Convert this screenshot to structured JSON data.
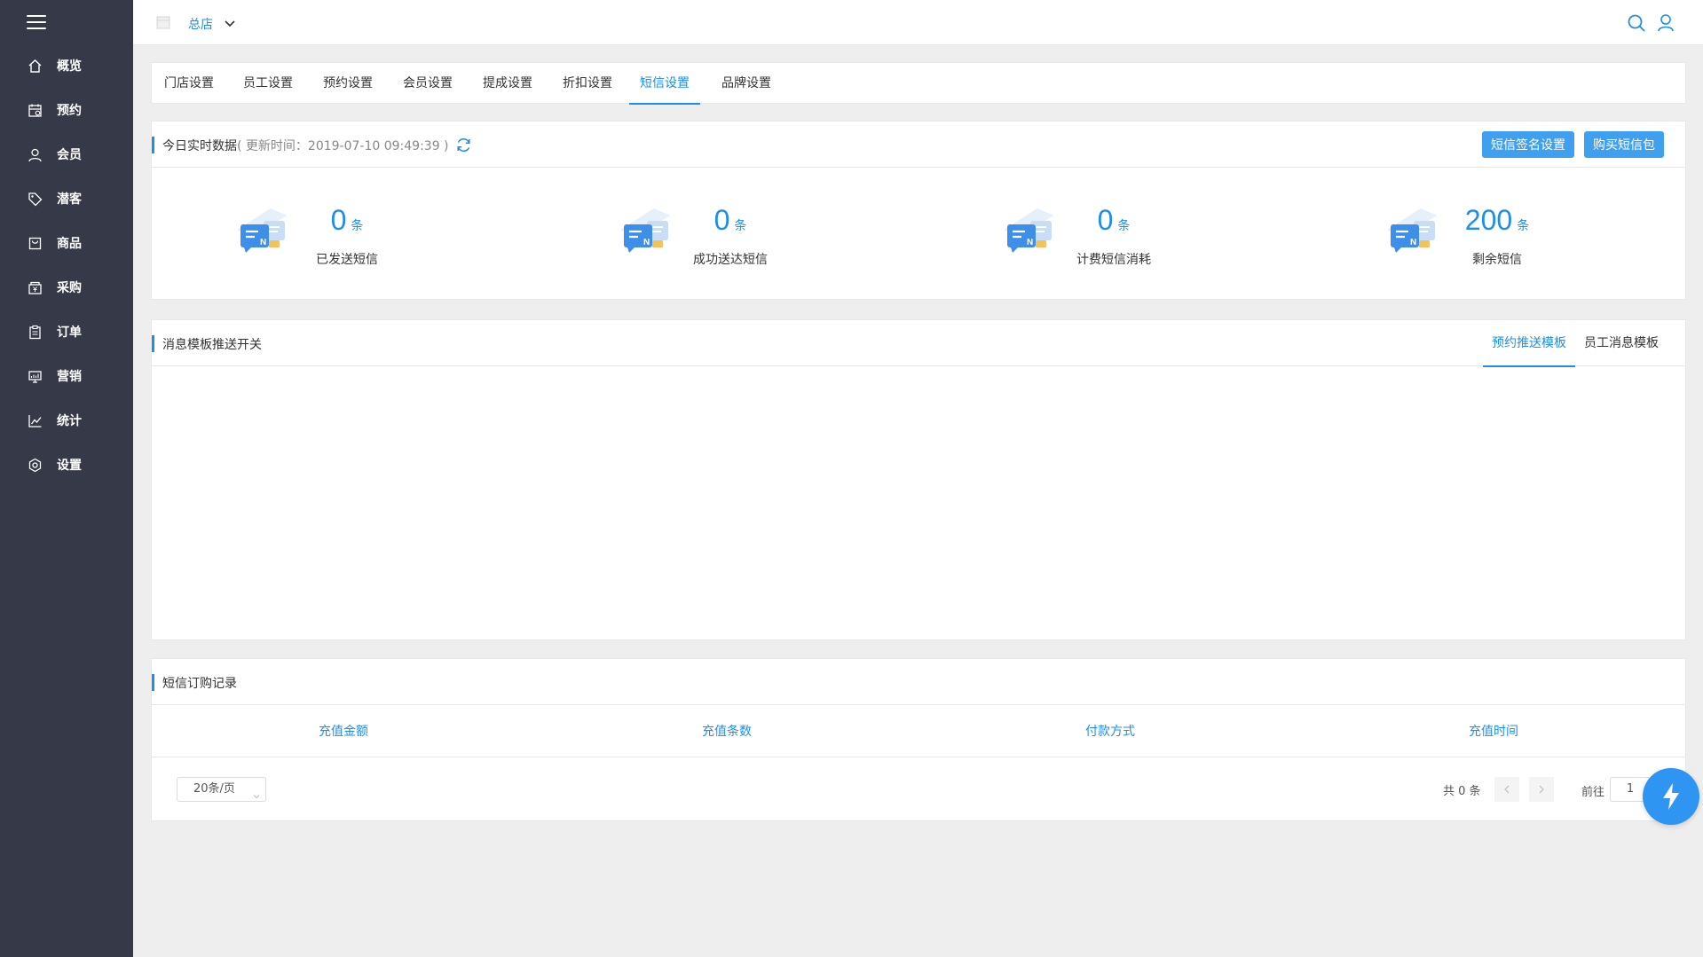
{
  "sidebar": {
    "items": [
      {
        "label": "概览",
        "icon": "home-icon"
      },
      {
        "label": "预约",
        "icon": "calendar-icon"
      },
      {
        "label": "会员",
        "icon": "user-icon"
      },
      {
        "label": "潜客",
        "icon": "tag-icon"
      },
      {
        "label": "商品",
        "icon": "shopping-bag-icon"
      },
      {
        "label": "采购",
        "icon": "purchase-icon"
      },
      {
        "label": "订单",
        "icon": "clipboard-icon"
      },
      {
        "label": "营销",
        "icon": "marketing-icon"
      },
      {
        "label": "统计",
        "icon": "chart-line-icon"
      },
      {
        "label": "设置",
        "icon": "gear-icon"
      }
    ]
  },
  "header": {
    "store_name": "总店"
  },
  "settings_tabs": [
    {
      "label": "门店设置"
    },
    {
      "label": "员工设置"
    },
    {
      "label": "预约设置"
    },
    {
      "label": "会员设置"
    },
    {
      "label": "提成设置"
    },
    {
      "label": "折扣设置"
    },
    {
      "label": "短信设置",
      "active": true
    },
    {
      "label": "品牌设置"
    }
  ],
  "realtime": {
    "title": "今日实时数据",
    "update_text": "( 更新时间：2019-07-10 09:49:39 )",
    "signature_button": "短信签名设置",
    "buy_button": "购买短信包",
    "stats": [
      {
        "value": "0",
        "unit": "条",
        "label": "已发送短信"
      },
      {
        "value": "0",
        "unit": "条",
        "label": "成功送达短信"
      },
      {
        "value": "0",
        "unit": "条",
        "label": "计费短信消耗"
      },
      {
        "value": "200",
        "unit": "条",
        "label": "剩余短信"
      }
    ]
  },
  "templates": {
    "title": "消息模板推送开关",
    "tabs": [
      {
        "label": "预约推送模板",
        "active": true
      },
      {
        "label": "员工消息模板"
      }
    ]
  },
  "records": {
    "title": "短信订购记录",
    "columns": [
      "充值金额",
      "充值条数",
      "付款方式",
      "充值时间"
    ],
    "rows": [],
    "page_size": "20条/页",
    "total": "共 0 条",
    "goto_label": "前往",
    "current_page": "1"
  },
  "colors": {
    "accent": "#1f8ee6",
    "sidebar_bg": "#363a48",
    "button_bg": "#3fa0f0"
  }
}
